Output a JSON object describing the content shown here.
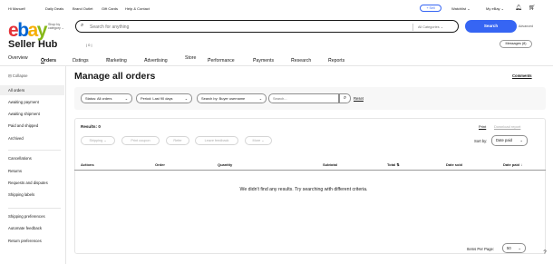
{
  "topbar": {
    "greeting": "Hi Manuel!",
    "daily_deals": "Daily Deals",
    "brand_outlet": "Brand Outlet",
    "gift_cards": "Gift Cards",
    "help_contact": "Help & Contact",
    "sell": "Sell",
    "watchlist": "Watchlist",
    "my_ebay": "My eBay"
  },
  "header": {
    "logo": [
      "e",
      "b",
      "a",
      "y"
    ],
    "shop_by": "Shop by category",
    "search_placeholder": "Search for anything",
    "category": "All Categories",
    "search_button": "Search",
    "advanced": "Advanced"
  },
  "page": {
    "title": "Seller Hub",
    "messages": "Messages (8)"
  },
  "nav": {
    "items": [
      "Overview",
      "Orders",
      "Listings",
      "Marketing",
      "Advertising",
      "Store",
      "Performance",
      "Payments",
      "Research",
      "Reports"
    ]
  },
  "sidebar": {
    "collapse": "Collapse",
    "items": [
      "All orders",
      "Awaiting payment",
      "Awaiting shipment",
      "Paid and shipped",
      "Archived",
      "Cancellations",
      "Returns",
      "Requests and disputes",
      "Shipping labels",
      "Shipping preferences",
      "Automate feedback",
      "Return preferences"
    ]
  },
  "main": {
    "heading": "Manage all orders",
    "comments": "Comments",
    "filters": {
      "status": "Status: All orders",
      "period": "Period: Last 90 days",
      "search_by": "Search by: Buyer username",
      "search_placeholder": "Search...",
      "reset": "Reset"
    },
    "results": "Results: 0",
    "print": "Print",
    "download": "Download report",
    "actions": [
      "Shipping",
      "Print coupon",
      "Refer",
      "Leave feedback",
      "More"
    ],
    "sort_label": "Sort by:",
    "sort_value": "Date paid",
    "columns": [
      "Actions",
      "Order",
      "Quantity",
      "Subtotal",
      "Total",
      "Date sold",
      "Date paid"
    ],
    "empty": "We didn't find any results. Try searching with different criteria.",
    "items_per_page_label": "Items Per Page:",
    "items_per_page": "50"
  },
  "colors": {
    "accent": "#3665f3"
  }
}
